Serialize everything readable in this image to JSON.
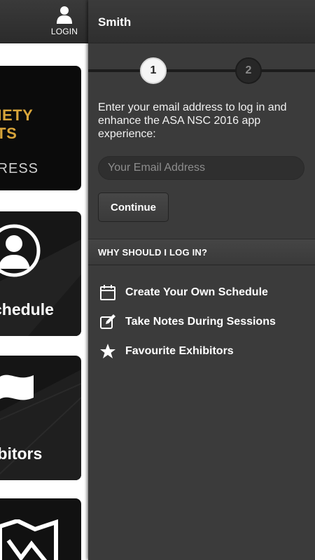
{
  "header": {
    "login_label": "LOGIN",
    "user_name": "Smith"
  },
  "background_tiles": {
    "tile1_line1": "CIETY",
    "tile1_line2": "STS",
    "tile1_line3": "GRESS",
    "tile2_label": "chedule",
    "tile3_label": "ibitors"
  },
  "login": {
    "steps": [
      "1",
      "2"
    ],
    "intro": "Enter your email address to log in and enhance the ASA NSC 2016 app experience:",
    "email_placeholder": "Your Email Address",
    "email_value": "",
    "continue_label": "Continue"
  },
  "why": {
    "heading": "WHY SHOULD I LOG IN?",
    "features": [
      {
        "label": "Create Your Own Schedule",
        "icon": "calendar-icon"
      },
      {
        "label": "Take Notes During Sessions",
        "icon": "edit-icon"
      },
      {
        "label": "Favourite Exhibitors",
        "icon": "star-icon"
      }
    ]
  },
  "colors": {
    "accent_gold": "#d9a53a",
    "panel_bg": "#3b3b3b",
    "text": "#ffffff"
  }
}
